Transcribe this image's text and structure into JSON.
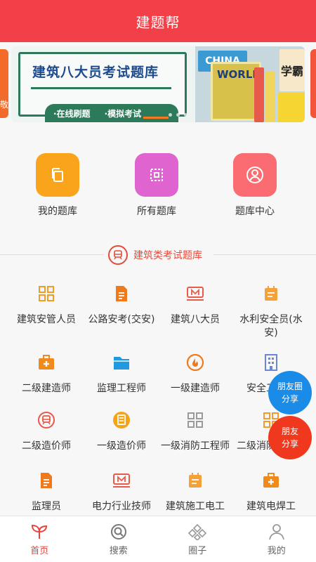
{
  "header": {
    "title": "建题帮"
  },
  "banner": {
    "title": "建筑八大员考试题库",
    "tags": [
      "·在线刷题",
      "·模拟考试"
    ],
    "book_texts": [
      "CHINA",
      "WORLD",
      "学霸"
    ],
    "side_text": "敬"
  },
  "quick_entries": [
    {
      "label": "我的题库",
      "icon": "copy-icon",
      "color": "#f9a41a"
    },
    {
      "label": "所有题库",
      "icon": "grid-square-icon",
      "color": "#e064d0"
    },
    {
      "label": "题库中心",
      "icon": "user-circle-icon",
      "color": "#fb6b72"
    }
  ],
  "section": {
    "title": "建筑类考试题库"
  },
  "exam_items": [
    {
      "label": "建筑安管人员",
      "icon": "grid-icon",
      "color": "#f39a2b"
    },
    {
      "label": "公路安考(交安)",
      "icon": "document-icon",
      "color": "#f07a19"
    },
    {
      "label": "建筑八大员",
      "icon": "m-board-icon",
      "color": "#e85a4a"
    },
    {
      "label": "水利安全员(水安)",
      "icon": "calendar-icon",
      "color": "#f3a23a"
    },
    {
      "label": "二级建造师",
      "icon": "medical-kit-icon",
      "color": "#f08a1c"
    },
    {
      "label": "监理工程师",
      "icon": "folder-icon",
      "color": "#1f9ae0"
    },
    {
      "label": "一级建造师",
      "icon": "fire-icon",
      "color": "#f07a19"
    },
    {
      "label": "安全工程师",
      "icon": "building-icon",
      "color": "#6a86d8"
    },
    {
      "label": "二级造价师",
      "icon": "train-icon",
      "color": "#e8574a"
    },
    {
      "label": "一级造价师",
      "icon": "receipt-icon",
      "color": "#f5a418"
    },
    {
      "label": "一级消防工程师",
      "icon": "grid-icon",
      "color": "#9a9a9a"
    },
    {
      "label": "二级消防工程师",
      "icon": "grid-icon",
      "color": "#f39a2b"
    },
    {
      "label": "监理员",
      "icon": "document-icon",
      "color": "#f07a19"
    },
    {
      "label": "电力行业技师",
      "icon": "m-board-icon",
      "color": "#e85a4a"
    },
    {
      "label": "建筑施工电工",
      "icon": "calendar-icon",
      "color": "#f3a23a"
    },
    {
      "label": "建筑电焊工",
      "icon": "medical-kit-icon",
      "color": "#f08a1c"
    }
  ],
  "float_buttons": {
    "moments": [
      "朋友圈",
      "分享"
    ],
    "friends": [
      "朋友",
      "分享"
    ]
  },
  "tabbar": [
    {
      "label": "首页",
      "icon": "sprout-icon",
      "active": true
    },
    {
      "label": "搜索",
      "icon": "search-icon",
      "active": false
    },
    {
      "label": "圈子",
      "icon": "diamond-cluster-icon",
      "active": false
    },
    {
      "label": "我的",
      "icon": "person-icon",
      "active": false
    }
  ],
  "colors": {
    "brand": "#f33f47",
    "accent_red": "#e34b3c"
  }
}
